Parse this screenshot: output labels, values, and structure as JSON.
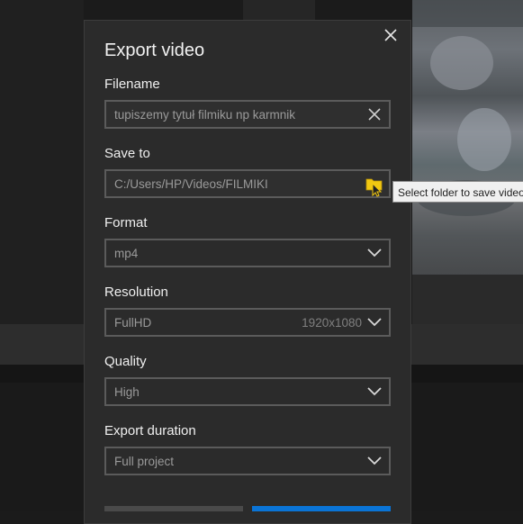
{
  "dialog": {
    "title": "Export video",
    "filename": {
      "label": "Filename",
      "value": "tupiszemy tytuł filmiku np karmnik"
    },
    "save_to": {
      "label": "Save to",
      "value": "C:/Users/HP/Videos/FILMIKI",
      "tooltip": "Select folder to save video"
    },
    "format": {
      "label": "Format",
      "value": "mp4"
    },
    "resolution": {
      "label": "Resolution",
      "value": "FullHD",
      "detail": "1920x1080"
    },
    "quality": {
      "label": "Quality",
      "value": "High"
    },
    "export_duration": {
      "label": "Export duration",
      "value": "Full project"
    }
  },
  "colors": {
    "dialog_bg": "#2b2b2b",
    "field_border": "#5b5b5b",
    "accent": "#0a74d6",
    "folder_icon": "#f2c811"
  },
  "icons": [
    "close-icon",
    "clear-icon",
    "folder-icon",
    "cursor-icon",
    "chevron-down-icon"
  ]
}
